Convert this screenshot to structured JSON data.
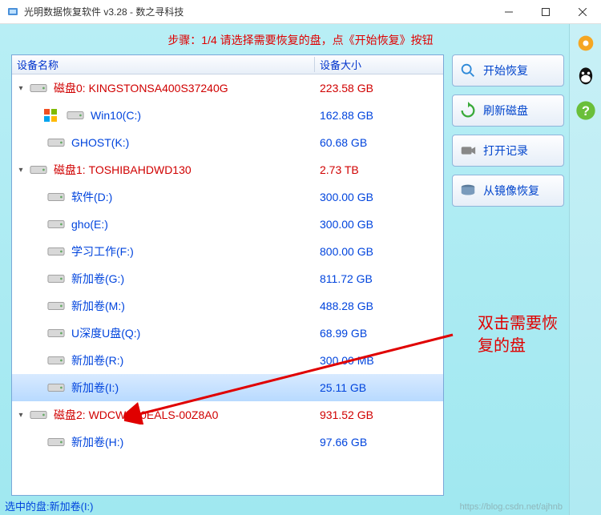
{
  "window": {
    "title": "光明数据恢复软件 v3.28 - 数之寻科技"
  },
  "step_hint": "步骤：1/4 请选择需要恢复的盘，点《开始恢复》按钮",
  "columns": {
    "name": "设备名称",
    "size": "设备大小"
  },
  "tree": [
    {
      "type": "disk",
      "label": "磁盘0: KINGSTONSA400S37240G",
      "size": "223.58 GB",
      "expanded": true
    },
    {
      "type": "vol",
      "label": "Win10(C:)",
      "size": "162.88 GB",
      "os": true
    },
    {
      "type": "vol",
      "label": "GHOST(K:)",
      "size": "60.68 GB"
    },
    {
      "type": "disk",
      "label": "磁盘1: TOSHIBAHDWD130",
      "size": "2.73 TB",
      "expanded": true
    },
    {
      "type": "vol",
      "label": "软件(D:)",
      "size": "300.00 GB"
    },
    {
      "type": "vol",
      "label": "gho(E:)",
      "size": "300.00 GB"
    },
    {
      "type": "vol",
      "label": "学习工作(F:)",
      "size": "800.00 GB"
    },
    {
      "type": "vol",
      "label": "新加卷(G:)",
      "size": "811.72 GB"
    },
    {
      "type": "vol",
      "label": "新加卷(M:)",
      "size": "488.28 GB"
    },
    {
      "type": "vol",
      "label": "U深度U盘(Q:)",
      "size": "68.99 GB"
    },
    {
      "type": "vol",
      "label": "新加卷(R:)",
      "size": "300.00 MB"
    },
    {
      "type": "vol",
      "label": "新加卷(I:)",
      "size": "25.11 GB",
      "selected": true
    },
    {
      "type": "disk",
      "label": "磁盘2: WDCWD10EALS-00Z8A0",
      "size": "931.52 GB",
      "expanded": true
    },
    {
      "type": "vol",
      "label": "新加卷(H:)",
      "size": "97.66 GB"
    }
  ],
  "actions": {
    "start": "开始恢复",
    "refresh": "刷新磁盘",
    "openlog": "打开记录",
    "fromimage": "从镜像恢复"
  },
  "status": "选中的盘:新加卷(I:)",
  "annotation": "双击需要恢\n复的盘",
  "watermark": "https://blog.csdn.net/ajhnb"
}
